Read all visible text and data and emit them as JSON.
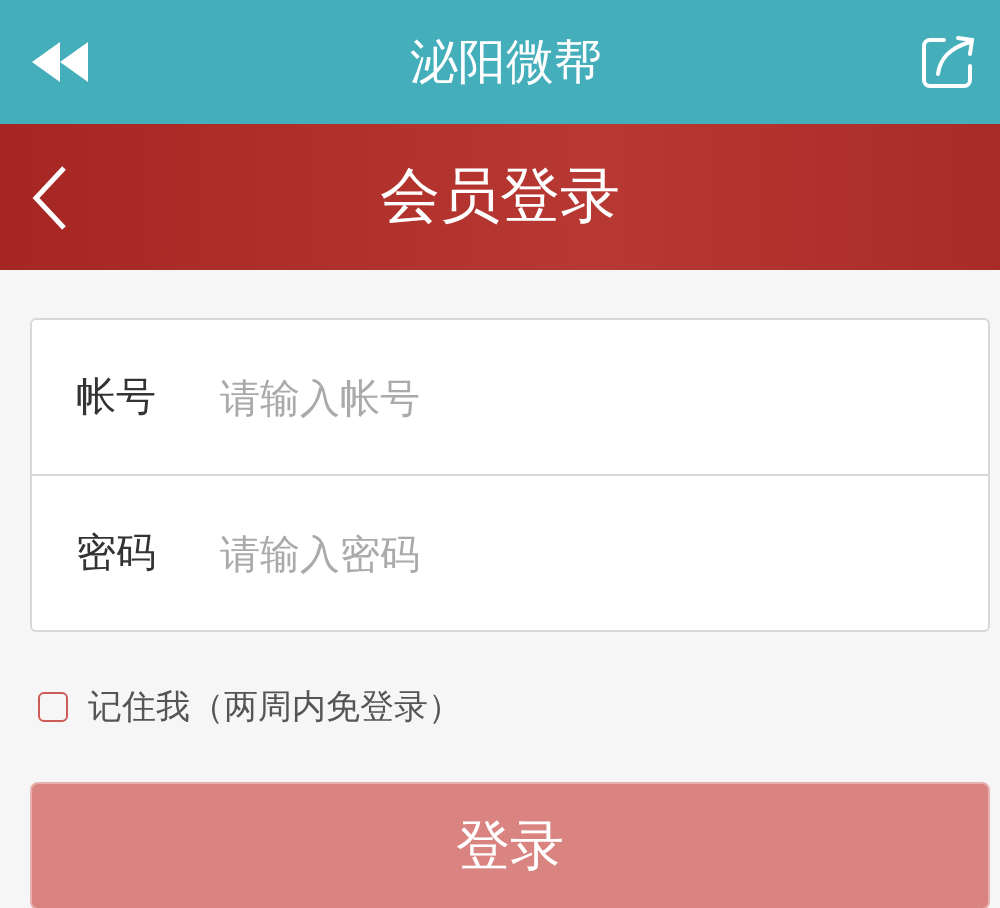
{
  "app_bar": {
    "title": "泌阳微帮"
  },
  "page_header": {
    "title": "会员登录"
  },
  "form": {
    "fields": [
      {
        "label": "帐号",
        "placeholder": "请输入帐号"
      },
      {
        "label": "密码",
        "placeholder": "请输入密码"
      }
    ]
  },
  "remember": {
    "label": "记住我（两周内免登录）",
    "checked": false
  },
  "login_button": {
    "label": "登录",
    "disabled": true
  }
}
